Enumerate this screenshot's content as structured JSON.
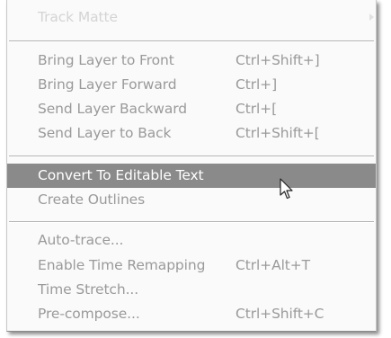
{
  "menu": {
    "track_matte": {
      "label": "Track Matte"
    },
    "arrange": [
      {
        "label": "Bring Layer to Front",
        "shortcut": "Ctrl+Shift+]"
      },
      {
        "label": "Bring Layer Forward",
        "shortcut": "Ctrl+]"
      },
      {
        "label": "Send Layer Backward",
        "shortcut": "Ctrl+["
      },
      {
        "label": "Send Layer to Back",
        "shortcut": "Ctrl+Shift+["
      }
    ],
    "text": [
      {
        "label": "Convert To Editable Text",
        "shortcut": ""
      },
      {
        "label": "Create Outlines",
        "shortcut": ""
      }
    ],
    "time": [
      {
        "label": "Auto-trace...",
        "shortcut": ""
      },
      {
        "label": "Enable Time Remapping",
        "shortcut": "Ctrl+Alt+T"
      },
      {
        "label": "Time Stretch...",
        "shortcut": ""
      },
      {
        "label": "Pre-compose...",
        "shortcut": "Ctrl+Shift+C"
      }
    ]
  },
  "colors": {
    "highlight_bg": "#8a8a8a",
    "highlight_text": "#ffffff",
    "item_text": "#9a9a9a",
    "faint_text": "#d4d4d4",
    "menu_bg": "#fafafa"
  },
  "icons": {
    "cursor": "arrow-cursor-icon",
    "submenu": "submenu-arrow-icon"
  }
}
